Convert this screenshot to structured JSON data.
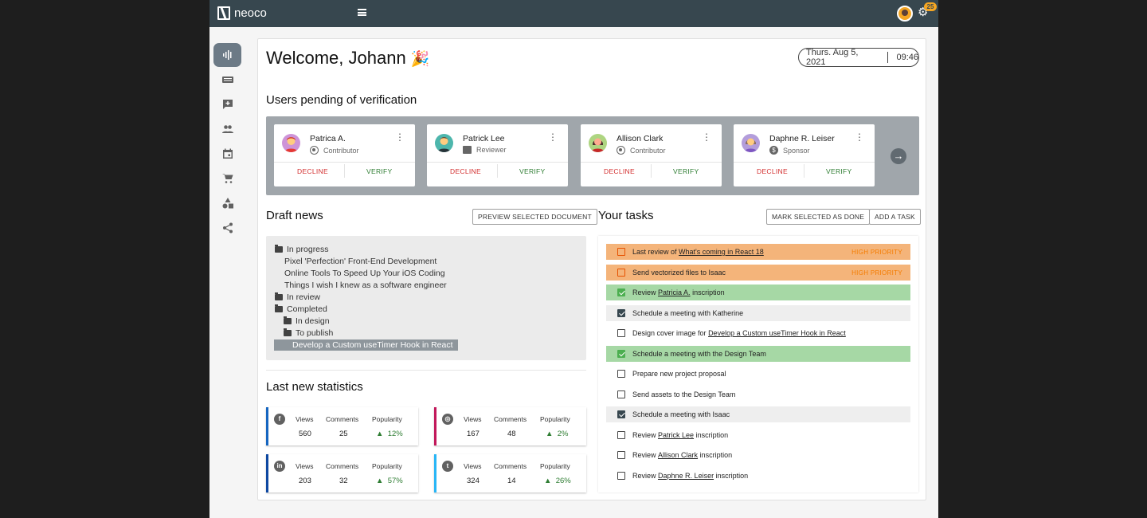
{
  "topbar": {
    "app_name": "neoco",
    "notification_count": "25"
  },
  "sidebar": {
    "items": [
      {
        "name": "dashboard",
        "active": true
      },
      {
        "name": "news"
      },
      {
        "name": "feedback"
      },
      {
        "name": "users"
      },
      {
        "name": "calendar"
      },
      {
        "name": "shop"
      },
      {
        "name": "categories"
      },
      {
        "name": "share"
      }
    ]
  },
  "header": {
    "welcome": "Welcome, Johann",
    "emoji": "🎉",
    "date": "Thurs. Aug 5, 2021",
    "time": "09:46"
  },
  "pending": {
    "title": "Users pending of verification",
    "decline_label": "DECLINE",
    "verify_label": "VERIFY",
    "users": [
      {
        "name": "Patrica A.",
        "role": "Contributor"
      },
      {
        "name": "Patrick Lee",
        "role": "Reviewer"
      },
      {
        "name": "Allison Clark",
        "role": "Contributor"
      },
      {
        "name": "Daphne R. Leiser",
        "role": "Sponsor"
      }
    ]
  },
  "draft": {
    "title": "Draft news",
    "preview_button": "PREVIEW SELECTED DOCUMENT",
    "tree": [
      "In progress",
      "Pixel 'Perfection' Front-End Development",
      "Online Tools To Speed Up Your iOS Coding",
      "Things I wish I knew as a software engineer",
      "In review",
      "Completed",
      "In design",
      "To publish",
      "Develop a Custom useTimer Hook in React"
    ]
  },
  "stats": {
    "title": "Last new statistics",
    "col_views": "Views",
    "col_comments": "Comments",
    "col_popularity": "Popularity",
    "cards": [
      {
        "network": "facebook",
        "views": "560",
        "comments": "25",
        "popularity": "12%",
        "color": "#1565c0"
      },
      {
        "network": "instagram",
        "views": "167",
        "comments": "48",
        "popularity": "2%",
        "color": "#c2185b"
      },
      {
        "network": "linkedin",
        "views": "203",
        "comments": "32",
        "popularity": "57%",
        "color": "#0d47a1"
      },
      {
        "network": "twitter",
        "views": "324",
        "comments": "14",
        "popularity": "26%",
        "color": "#29b6f6"
      }
    ]
  },
  "tasks": {
    "title": "Your tasks",
    "mark_done_button": "MARK SELECTED AS DONE",
    "add_task_button": "ADD A TASK",
    "high_priority_label": "HIGH PRIORITY",
    "items": [
      {
        "pre": "Last review of ",
        "link": "What's coming in React 18",
        "post": ""
      },
      {
        "pre": "Send vectorized files to Isaac",
        "link": "",
        "post": ""
      },
      {
        "pre": "Review ",
        "link": "Patricia A.",
        "post": " inscription"
      },
      {
        "pre": "Schedule a meeting with Katherine",
        "link": "",
        "post": ""
      },
      {
        "pre": "Design cover image for ",
        "link": "Develop a Custom useTimer Hook in React",
        "post": ""
      },
      {
        "pre": "Schedule a meeting with the Design Team",
        "link": "",
        "post": ""
      },
      {
        "pre": "Prepare new project proposal",
        "link": "",
        "post": ""
      },
      {
        "pre": "Send assets to the Design Team",
        "link": "",
        "post": ""
      },
      {
        "pre": "Schedule a meeting with Isaac",
        "link": "",
        "post": ""
      },
      {
        "pre": "Review ",
        "link": "Patrick Lee",
        "post": " inscription"
      },
      {
        "pre": "Review ",
        "link": "Allison Clark",
        "post": " inscription"
      },
      {
        "pre": "Review ",
        "link": "Daphne R. Leiser",
        "post": " inscription"
      }
    ]
  }
}
